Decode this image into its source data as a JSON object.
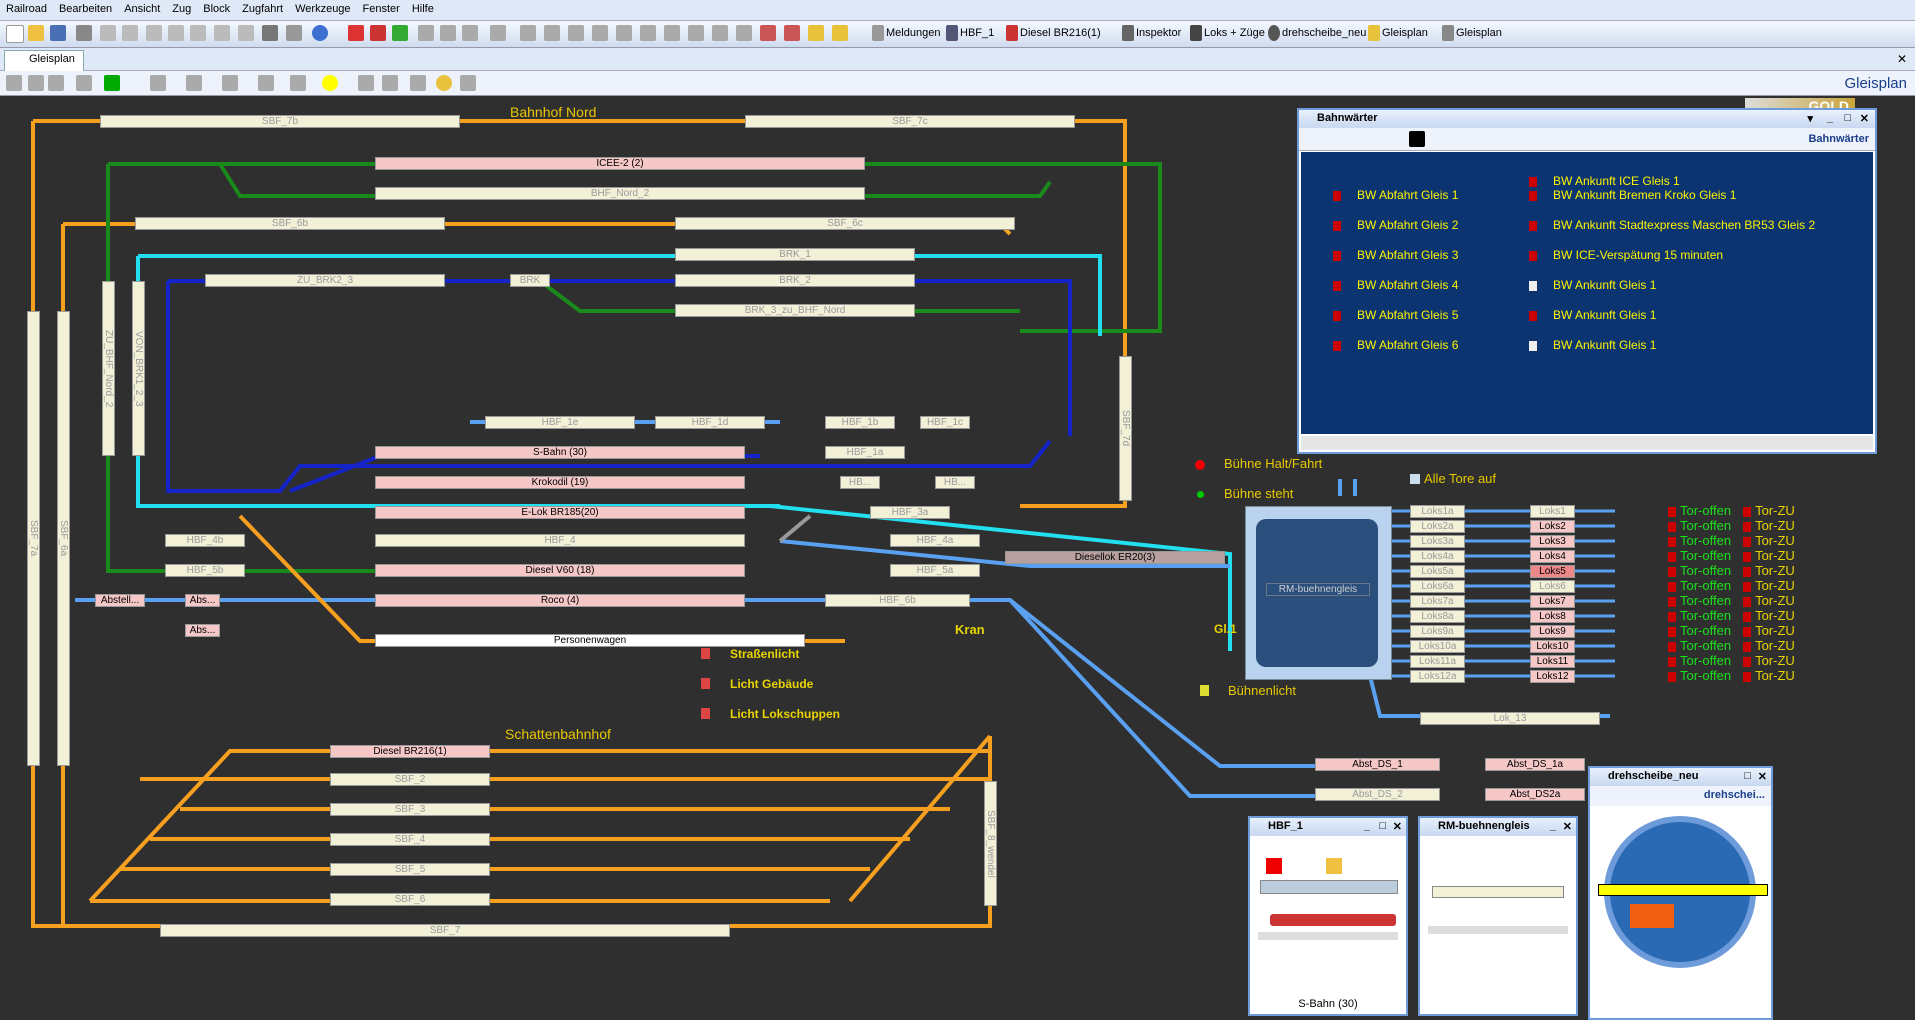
{
  "menu": [
    "Railroad",
    "Bearbeiten",
    "Ansicht",
    "Zug",
    "Block",
    "Zugfahrt",
    "Werkzeuge",
    "Fenster",
    "Hilfe"
  ],
  "toolbar_buttons": [
    "Meldungen",
    "HBF_1",
    "Diesel BR216(1)",
    "Inspektor",
    "Loks + Züge",
    "drehscheibe_neu",
    "Gleisplan",
    "Gleisplan"
  ],
  "tab": {
    "label": "Gleisplan"
  },
  "edition": "GOLD",
  "view_title": "Gleisplan",
  "labels": {
    "bahnhof_nord": "Bahnhof Nord",
    "schattenbahnhof": "Schattenbahnhof",
    "kran": "Kran",
    "strassenlicht": "Straßenlicht",
    "licht_gebaeude": "Licht Gebäude",
    "licht_lokschuppen": "Licht Lokschuppen",
    "buehne_halt": "Bühne Halt/Fahrt",
    "buehne_steht": "Bühne steht",
    "alle_tore": "Alle Tore auf",
    "gl1": "Gl.1",
    "buehnenlicht": "Bühnenlicht"
  },
  "tracks": {
    "sbf7b": "SBF_7b",
    "sbf7c": "SBF_7c",
    "icee2": "ICEE-2 (2)",
    "bhfnord2": "BHF_Nord_2",
    "sbf6b": "SBF_6b",
    "sbf6c": "SBF_6c",
    "brk1": "BRK_1",
    "zubrk23": "ZU_BRK2_3",
    "brk": "BRK",
    "brk2": "BRK_2",
    "brk3": "BRK_3_zu_BHF_Nord",
    "hbf1e": "HBF_1e",
    "hbf1d": "HBF_1d",
    "hbf1b": "HBF_1b",
    "hbf1c": "HBF_1c",
    "sbahn": "S-Bahn (30)",
    "hbf1a": "HBF_1a",
    "krokodil": "Krokodil (19)",
    "hb1": "HB...",
    "hb2": "HB...",
    "elok": "E-Lok BR185(20)",
    "hbf3a": "HBF_3a",
    "hbf4b": "HBF_4b",
    "hbf4": "HBF_4",
    "hbf4a": "HBF_4a",
    "hbf5b": "HBF_5b",
    "dieselv60": "Diesel V60 (18)",
    "hbf5a": "HBF_5a",
    "diesellok": "Diesellok ER20(3)",
    "abstell": "Abstell...",
    "abs1": "Abs...",
    "roco": "Roco (4)",
    "hbf6b": "HBF_6b",
    "abs2": "Abs...",
    "personenwagen": "Personenwagen",
    "dieselbr216": "Diesel BR216(1)",
    "sbf2": "SBF_2",
    "sbf3": "SBF_3",
    "sbf4": "SBF_4",
    "sbf5": "SBF_5",
    "sbf6": "SBF_6",
    "sbf7": "SBF_7",
    "rm_buehne": "RM-buehnengleis",
    "lok13": "Lok_13",
    "abstds1": "Abst_DS_1",
    "abstds1a": "Abst_DS_1a",
    "abstds2": "Abst_DS_2",
    "abstds2a": "Abst_DS2a",
    "sbf7a": "SBF_7a",
    "sbf6a": "SBF_6a",
    "zubhfnord2": "ZU_BHF_Nord_2",
    "vonbrk123": "VON_BRK1_2_3",
    "sbf7d": "SBF_7d",
    "sbf8": "SBF_8_wendel"
  },
  "loks_left": [
    "Loks1a",
    "Loks2a",
    "Loks3a",
    "Loks4a",
    "Loks5a",
    "Loks6a",
    "Loks7a",
    "Loks8a",
    "Loks9a",
    "Loks10a",
    "Loks11a",
    "Loks12a"
  ],
  "loks_right": [
    "Loks1",
    "Loks2",
    "Loks3",
    "Loks4",
    "Loks5",
    "Loks6",
    "Loks7",
    "Loks8",
    "Loks9",
    "Loks10",
    "Loks11",
    "Loks12"
  ],
  "tor_offen": "Tor-offen",
  "tor_zu": "Tor-ZU",
  "bahnwaerter": {
    "title": "Bahnwärter",
    "toolbar_label": "Bahnwärter",
    "left": [
      "BW  Abfahrt Gleis 1",
      "BW  Abfahrt Gleis 2",
      "BW  Abfahrt Gleis 3",
      "BW  Abfahrt Gleis 4",
      "BW  Abfahrt Gleis 5",
      "BW  Abfahrt Gleis 6"
    ],
    "right": [
      "BW  Ankunft ICE Gleis 1",
      "BW  Ankunft Bremen Kroko Gleis 1",
      "BW  Ankunft Stadtexpress Maschen BR53 Gleis 2",
      "BW  ICE-Verspätung 15 minuten",
      "BW  Ankunft Gleis 1",
      "BW  Ankunft Gleis 1",
      "BW  Ankunft Gleis 1"
    ]
  },
  "hbf1_window": {
    "title": "HBF_1",
    "footer": "S-Bahn (30)"
  },
  "rm_window": {
    "title": "RM-buehnengleis"
  },
  "ds_window": {
    "title": "drehscheibe_neu",
    "label": "drehschei..."
  }
}
